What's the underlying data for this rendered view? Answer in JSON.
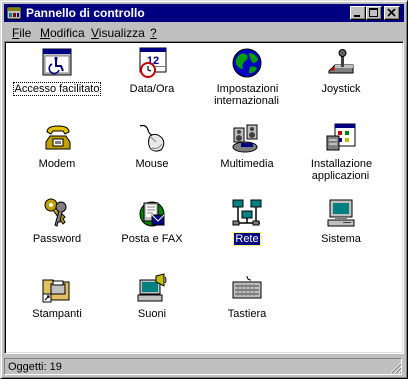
{
  "window": {
    "title": "Pannello di controllo"
  },
  "menu": [
    {
      "label": "File",
      "accel": "F",
      "rest": "ile"
    },
    {
      "label": "Modifica",
      "accel": "M",
      "rest": "odifica"
    },
    {
      "label": "Visualizza",
      "accel": "V",
      "rest": "isualizza"
    },
    {
      "label": "?",
      "accel": "?",
      "rest": ""
    }
  ],
  "items": [
    {
      "label": "Accesso facilitato",
      "icon": "accessibility-icon"
    },
    {
      "label": "Data/Ora",
      "icon": "calendar-clock-icon",
      "cal_text": "12"
    },
    {
      "label": "Impostazioni internazionali",
      "icon": "globe-icon"
    },
    {
      "label": "Joystick",
      "icon": "joystick-icon"
    },
    {
      "label": "Modem",
      "icon": "modem-phone-icon"
    },
    {
      "label": "Mouse",
      "icon": "mouse-icon"
    },
    {
      "label": "Multimedia",
      "icon": "multimedia-icon"
    },
    {
      "label": "Installazione applicazioni",
      "icon": "install-apps-icon"
    },
    {
      "label": "Password",
      "icon": "keys-icon"
    },
    {
      "label": "Posta e FAX",
      "icon": "mail-fax-icon"
    },
    {
      "label": "Rete",
      "icon": "network-icon"
    },
    {
      "label": "Sistema",
      "icon": "computer-icon"
    },
    {
      "label": "Stampanti",
      "icon": "printers-folder-icon"
    },
    {
      "label": "Suoni",
      "icon": "sounds-icon"
    },
    {
      "label": "Tastiera",
      "icon": "keyboard-icon"
    }
  ],
  "selection": {
    "focused": "Accesso facilitato",
    "selected": "Rete"
  },
  "status": {
    "text": "Oggetti: 19"
  },
  "colors": {
    "titlebar": "#000080",
    "face": "#c0c0c0",
    "selection": "#000080"
  }
}
